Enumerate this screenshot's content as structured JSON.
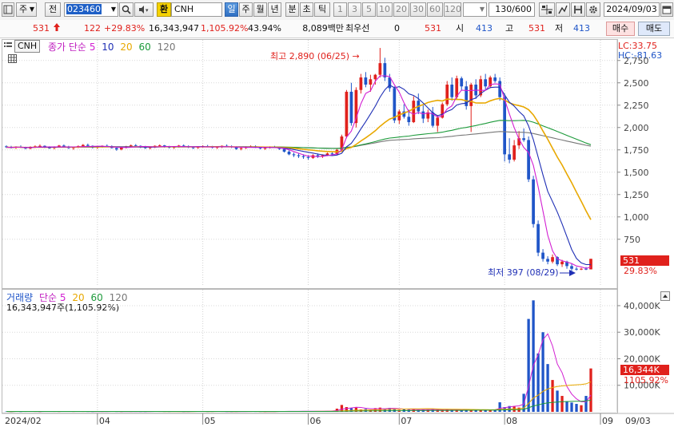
{
  "toolbar": {
    "market": "주",
    "type_btn": "전",
    "code": "023460",
    "exchange_badge": "환",
    "name": "CNH",
    "periods": [
      "일",
      "주",
      "월",
      "년",
      "분",
      "초",
      "틱"
    ],
    "intervals": [
      "1",
      "3",
      "5",
      "10",
      "20",
      "30",
      "60",
      "120"
    ],
    "count": "130/600",
    "date": "2024/09/03"
  },
  "quote": {
    "price": "531",
    "change": "122",
    "change_rate": "+29.83%",
    "volume": "16,343,947",
    "volume_rate": "1,105.92%",
    "turnover": "43.94%",
    "amount": "8,089백만",
    "priority_label": "최우선",
    "priority_value": "0",
    "priority_price": "531",
    "open_label": "시",
    "open": "413",
    "high_label": "고",
    "high": "531",
    "low_label": "저",
    "low": "413",
    "sell_btn": "매수",
    "buy_btn": "매도"
  },
  "price_legend": {
    "name": "CNH",
    "ma_label": "종가 단순",
    "ma_periods": [
      "5",
      "10",
      "20",
      "60",
      "120"
    ],
    "ma_colors": [
      "#d21fd2",
      "#1f2fb5",
      "#e8a800",
      "#1c9a3a",
      "#777777"
    ],
    "lc": "LC:33.75",
    "hc": "HC:-81.63"
  },
  "volume_legend": {
    "label": "거래량",
    "ma_label": "단순",
    "ma_periods": [
      "5",
      "20",
      "60",
      "120"
    ],
    "ma_colors": [
      "#d21fd2",
      "#e8a800",
      "#1c9a3a",
      "#777777"
    ],
    "value": "16,343,947주(1,105.92%)"
  },
  "annotations": {
    "high": "최고 2,890 (06/25)",
    "low": "최저 397 (08/29)"
  },
  "price_tag": {
    "value": "531",
    "rate": "29.83%"
  },
  "volume_tag": {
    "value": "16,344K",
    "rate": "1105.92%"
  },
  "colors": {
    "up": "#e0211c",
    "down": "#1f55c8"
  },
  "chart_data": {
    "type": "candlestick",
    "price_axis": {
      "ticks": [
        2750,
        2500,
        2250,
        2000,
        1750,
        1500,
        1250,
        1000,
        750
      ],
      "tick_labels": [
        "2,750",
        "2,500",
        "2,250",
        "2,000",
        "1,750",
        "1,500",
        "1,250",
        "1,000",
        "750"
      ],
      "range": [
        230,
        2980
      ]
    },
    "volume_axis": {
      "ticks": [
        40000,
        30000,
        20000,
        10000
      ],
      "tick_labels": [
        "40,000K",
        "30,000K",
        "20,000K",
        "10,000K"
      ],
      "range": [
        0,
        46000
      ]
    },
    "x_labels": [
      "2024/02",
      "04",
      "05",
      "06",
      "07",
      "08",
      "09",
      "09/03"
    ],
    "candles": [
      [
        1790,
        1800,
        1770,
        1780
      ],
      [
        1780,
        1795,
        1765,
        1775
      ],
      [
        1775,
        1790,
        1760,
        1785
      ],
      [
        1785,
        1800,
        1770,
        1775
      ],
      [
        1775,
        1785,
        1755,
        1765
      ],
      [
        1765,
        1790,
        1755,
        1782
      ],
      [
        1782,
        1800,
        1770,
        1790
      ],
      [
        1790,
        1810,
        1780,
        1795
      ],
      [
        1795,
        1800,
        1770,
        1775
      ],
      [
        1775,
        1790,
        1760,
        1770
      ],
      [
        1770,
        1790,
        1755,
        1785
      ],
      [
        1785,
        1805,
        1775,
        1798
      ],
      [
        1798,
        1810,
        1780,
        1785
      ],
      [
        1785,
        1795,
        1760,
        1770
      ],
      [
        1770,
        1785,
        1750,
        1778
      ],
      [
        1778,
        1800,
        1770,
        1792
      ],
      [
        1792,
        1815,
        1785,
        1805
      ],
      [
        1805,
        1820,
        1790,
        1795
      ],
      [
        1795,
        1800,
        1765,
        1775
      ],
      [
        1775,
        1790,
        1760,
        1785
      ],
      [
        1785,
        1800,
        1775,
        1795
      ],
      [
        1795,
        1810,
        1785,
        1790
      ],
      [
        1790,
        1800,
        1765,
        1770
      ],
      [
        1770,
        1780,
        1740,
        1755
      ],
      [
        1755,
        1780,
        1745,
        1775
      ],
      [
        1775,
        1795,
        1765,
        1790
      ],
      [
        1790,
        1810,
        1780,
        1800
      ],
      [
        1800,
        1815,
        1790,
        1795
      ],
      [
        1795,
        1800,
        1770,
        1780
      ],
      [
        1780,
        1795,
        1760,
        1770
      ],
      [
        1770,
        1785,
        1755,
        1780
      ],
      [
        1780,
        1800,
        1770,
        1795
      ],
      [
        1795,
        1810,
        1785,
        1800
      ],
      [
        1800,
        1805,
        1775,
        1785
      ],
      [
        1785,
        1795,
        1765,
        1775
      ],
      [
        1775,
        1790,
        1760,
        1785
      ],
      [
        1785,
        1805,
        1775,
        1798
      ],
      [
        1798,
        1810,
        1785,
        1790
      ],
      [
        1790,
        1800,
        1770,
        1778
      ],
      [
        1778,
        1790,
        1760,
        1772
      ],
      [
        1772,
        1790,
        1762,
        1786
      ],
      [
        1786,
        1800,
        1775,
        1792
      ],
      [
        1792,
        1805,
        1780,
        1785
      ],
      [
        1785,
        1795,
        1765,
        1775
      ],
      [
        1775,
        1790,
        1760,
        1782
      ],
      [
        1782,
        1800,
        1770,
        1795
      ],
      [
        1795,
        1810,
        1785,
        1790
      ],
      [
        1790,
        1800,
        1770,
        1780
      ],
      [
        1780,
        1790,
        1750,
        1760
      ],
      [
        1760,
        1780,
        1745,
        1770
      ],
      [
        1770,
        1790,
        1760,
        1785
      ],
      [
        1785,
        1800,
        1775,
        1790
      ],
      [
        1790,
        1800,
        1770,
        1775
      ],
      [
        1775,
        1785,
        1755,
        1765
      ],
      [
        1765,
        1780,
        1750,
        1772
      ],
      [
        1772,
        1790,
        1765,
        1785
      ],
      [
        1785,
        1795,
        1770,
        1778
      ],
      [
        1778,
        1785,
        1750,
        1760
      ],
      [
        1760,
        1770,
        1720,
        1730
      ],
      [
        1730,
        1745,
        1690,
        1700
      ],
      [
        1700,
        1720,
        1670,
        1690
      ],
      [
        1690,
        1710,
        1660,
        1680
      ],
      [
        1680,
        1700,
        1650,
        1670
      ],
      [
        1670,
        1690,
        1640,
        1660
      ],
      [
        1660,
        1700,
        1650,
        1690
      ],
      [
        1690,
        1710,
        1660,
        1675
      ],
      [
        1675,
        1700,
        1660,
        1690
      ],
      [
        1690,
        1720,
        1680,
        1710
      ],
      [
        1710,
        1730,
        1690,
        1700
      ],
      [
        1700,
        1760,
        1690,
        1750
      ],
      [
        1750,
        1920,
        1740,
        1900
      ],
      [
        1900,
        2420,
        1880,
        2400
      ],
      [
        2400,
        2500,
        2020,
        2050
      ],
      [
        2050,
        2450,
        2000,
        2420
      ],
      [
        2420,
        2600,
        2380,
        2560
      ],
      [
        2560,
        2620,
        2450,
        2480
      ],
      [
        2480,
        2590,
        2400,
        2540
      ],
      [
        2540,
        2600,
        2480,
        2590
      ],
      [
        2590,
        2890,
        2560,
        2720
      ],
      [
        2720,
        2780,
        2520,
        2560
      ],
      [
        2560,
        2600,
        2400,
        2440
      ],
      [
        2440,
        2460,
        2050,
        2080
      ],
      [
        2080,
        2200,
        2040,
        2180
      ],
      [
        2180,
        2260,
        2100,
        2120
      ],
      [
        2120,
        2200,
        2020,
        2060
      ],
      [
        2060,
        2350,
        2050,
        2300
      ],
      [
        2300,
        2380,
        2150,
        2180
      ],
      [
        2180,
        2250,
        2050,
        2100
      ],
      [
        2100,
        2200,
        2060,
        2170
      ],
      [
        2170,
        2230,
        2000,
        2020
      ],
      [
        2020,
        2140,
        1950,
        2110
      ],
      [
        2110,
        2280,
        2100,
        2260
      ],
      [
        2260,
        2520,
        2240,
        2480
      ],
      [
        2480,
        2560,
        2300,
        2340
      ],
      [
        2340,
        2580,
        2320,
        2550
      ],
      [
        2550,
        2570,
        2420,
        2460
      ],
      [
        2460,
        2520,
        2200,
        2240
      ],
      [
        2240,
        2500,
        1950,
        2480
      ],
      [
        2480,
        2540,
        2320,
        2360
      ],
      [
        2360,
        2580,
        2340,
        2540
      ],
      [
        2540,
        2600,
        2420,
        2460
      ],
      [
        2460,
        2580,
        2440,
        2560
      ],
      [
        2560,
        2600,
        2500,
        2520
      ],
      [
        2520,
        2560,
        2300,
        2340
      ],
      [
        2340,
        2380,
        1620,
        1700
      ],
      [
        1700,
        1880,
        1600,
        1640
      ],
      [
        1640,
        1860,
        1620,
        1800
      ],
      [
        1800,
        1960,
        1760,
        1880
      ],
      [
        1880,
        1990,
        1840,
        1860
      ],
      [
        1860,
        1900,
        1390,
        1420
      ],
      [
        1420,
        1460,
        880,
        920
      ],
      [
        920,
        960,
        560,
        600
      ],
      [
        600,
        640,
        500,
        530
      ],
      [
        530,
        560,
        470,
        500
      ],
      [
        500,
        580,
        480,
        550
      ],
      [
        550,
        560,
        450,
        470
      ],
      [
        470,
        520,
        440,
        500
      ],
      [
        500,
        510,
        420,
        450
      ],
      [
        450,
        480,
        397,
        420
      ],
      [
        420,
        440,
        400,
        415
      ],
      [
        415,
        430,
        405,
        420
      ],
      [
        420,
        440,
        405,
        413
      ],
      [
        413,
        531,
        413,
        531
      ]
    ],
    "volumes": [
      150,
      120,
      180,
      100,
      140,
      160,
      130,
      110,
      150,
      170,
      140,
      120,
      180,
      150,
      130,
      160,
      140,
      120,
      110,
      150,
      130,
      140,
      160,
      120,
      110,
      150,
      130,
      140,
      120,
      110,
      150,
      160,
      140,
      130,
      120,
      150,
      140,
      110,
      130,
      150,
      160,
      140,
      120,
      130,
      150,
      140,
      120,
      110,
      130,
      150,
      160,
      140,
      130,
      120,
      110,
      150,
      140,
      160,
      180,
      200,
      220,
      180,
      200,
      240,
      220,
      260,
      280,
      300,
      400,
      1200,
      2600,
      1800,
      1400,
      1600,
      900,
      1100,
      800,
      1400,
      1600,
      1000,
      1500,
      1100,
      700,
      900,
      800,
      1000,
      700,
      800,
      900,
      1000,
      800,
      700,
      900,
      800,
      600,
      700,
      800,
      900,
      700,
      600,
      800,
      700,
      900,
      3600,
      1800,
      2200,
      2000,
      1600,
      6800,
      35000,
      42000,
      22000,
      30000,
      18000,
      12000,
      8000,
      6000,
      4000,
      3500,
      3000,
      2500,
      6000,
      16344
    ]
  }
}
